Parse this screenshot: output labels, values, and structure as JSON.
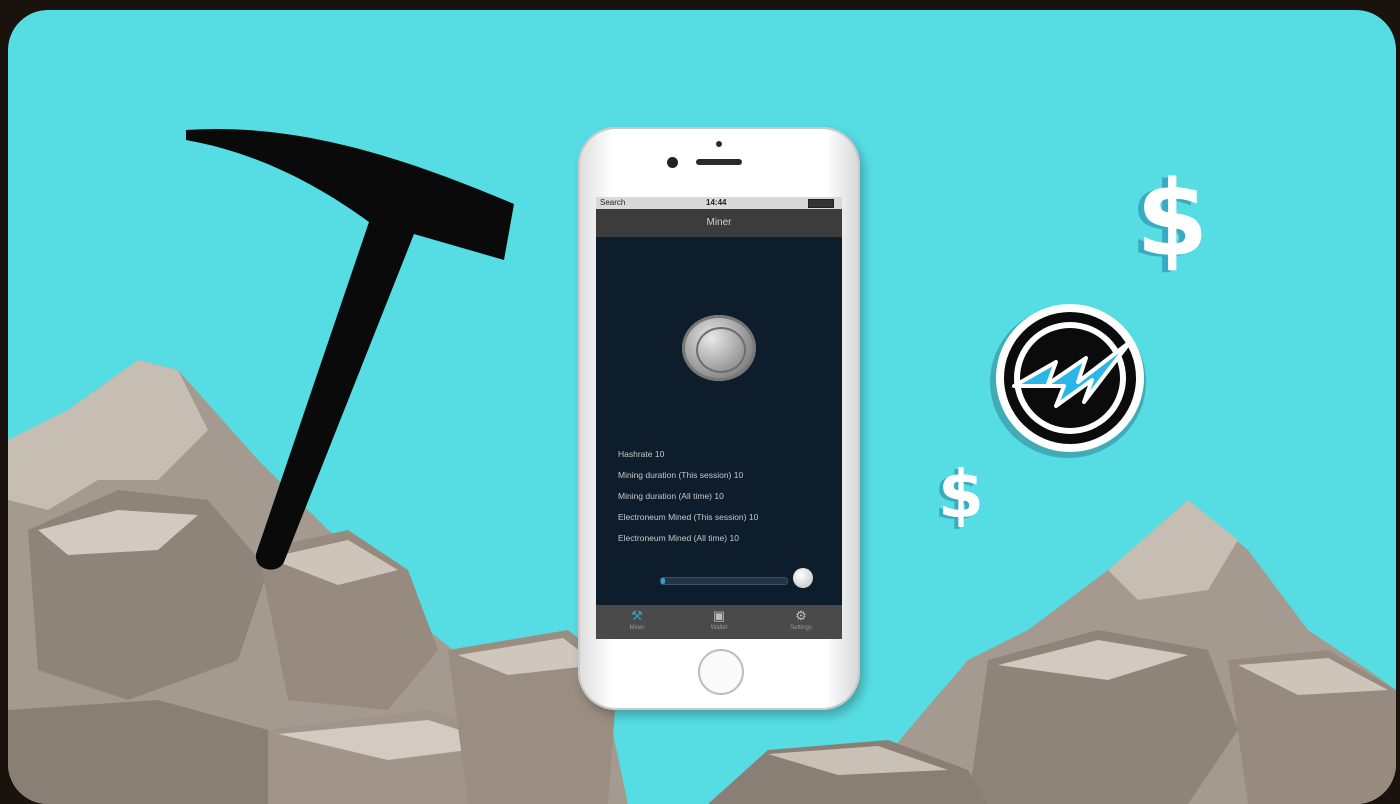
{
  "phone": {
    "status_left": "Search",
    "status_time": "14:44",
    "screen_title": "Miner",
    "stats": [
      "Hashrate 10",
      "Mining duration (This session) 10",
      "Mining duration (All time) 10",
      "Electroneum Mined (This session) 10",
      "Electroneum Mined (All time) 10"
    ],
    "progress_fraction": 0.03,
    "tabs": [
      {
        "label": "Miner",
        "icon": "pickaxe-icon"
      },
      {
        "label": "Wallet",
        "icon": "wallet-icon"
      },
      {
        "label": "Settings",
        "icon": "gear-icon"
      }
    ]
  },
  "decor": {
    "dollar_large": "$",
    "dollar_small": "$"
  },
  "colors": {
    "sky": "#56dde3",
    "rock": "#9b8f83",
    "etn_blue": "#2ab6e6"
  }
}
